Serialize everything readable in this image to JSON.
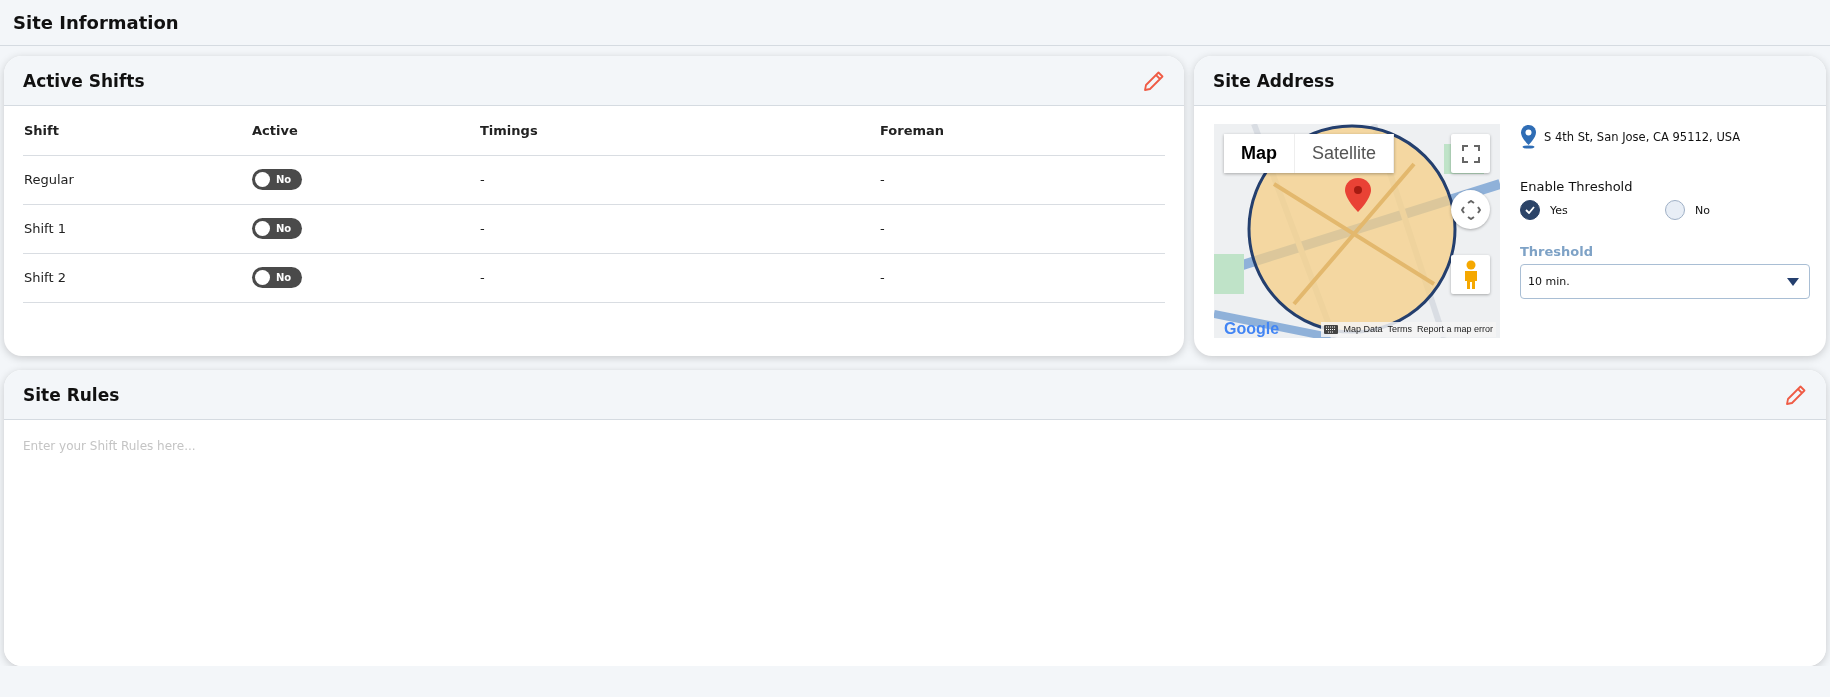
{
  "page": {
    "title": "Site Information"
  },
  "active_shifts": {
    "title": "Active Shifts",
    "columns": [
      "Shift",
      "Active",
      "Timings",
      "Foreman"
    ],
    "rows": [
      {
        "shift": "Regular",
        "active": {
          "on": false,
          "label": "No"
        },
        "timings": "-",
        "foreman": "-"
      },
      {
        "shift": "Shift 1",
        "active": {
          "on": false,
          "label": "No"
        },
        "timings": "-",
        "foreman": "-"
      },
      {
        "shift": "Shift 2",
        "active": {
          "on": false,
          "label": "No"
        },
        "timings": "-",
        "foreman": "-"
      }
    ]
  },
  "site_address": {
    "title": "Site Address",
    "map": {
      "kind": "picture",
      "map_types": [
        {
          "label": "Map",
          "selected": true
        },
        {
          "label": "Satellite",
          "selected": false
        }
      ],
      "attribution": {
        "logo": "Google",
        "links": [
          "Map Data",
          "Terms",
          "Report a map error"
        ]
      }
    },
    "address": "S 4th St, San Jose, CA 95112, USA",
    "enable_threshold": {
      "label": "Enable Threshold",
      "options": [
        {
          "label": "Yes",
          "selected": true
        },
        {
          "label": "No",
          "selected": false
        }
      ]
    },
    "threshold": {
      "label": "Threshold",
      "value": "10 min."
    }
  },
  "site_rules": {
    "title": "Site Rules",
    "placeholder": "Enter your Shift Rules here..."
  }
}
